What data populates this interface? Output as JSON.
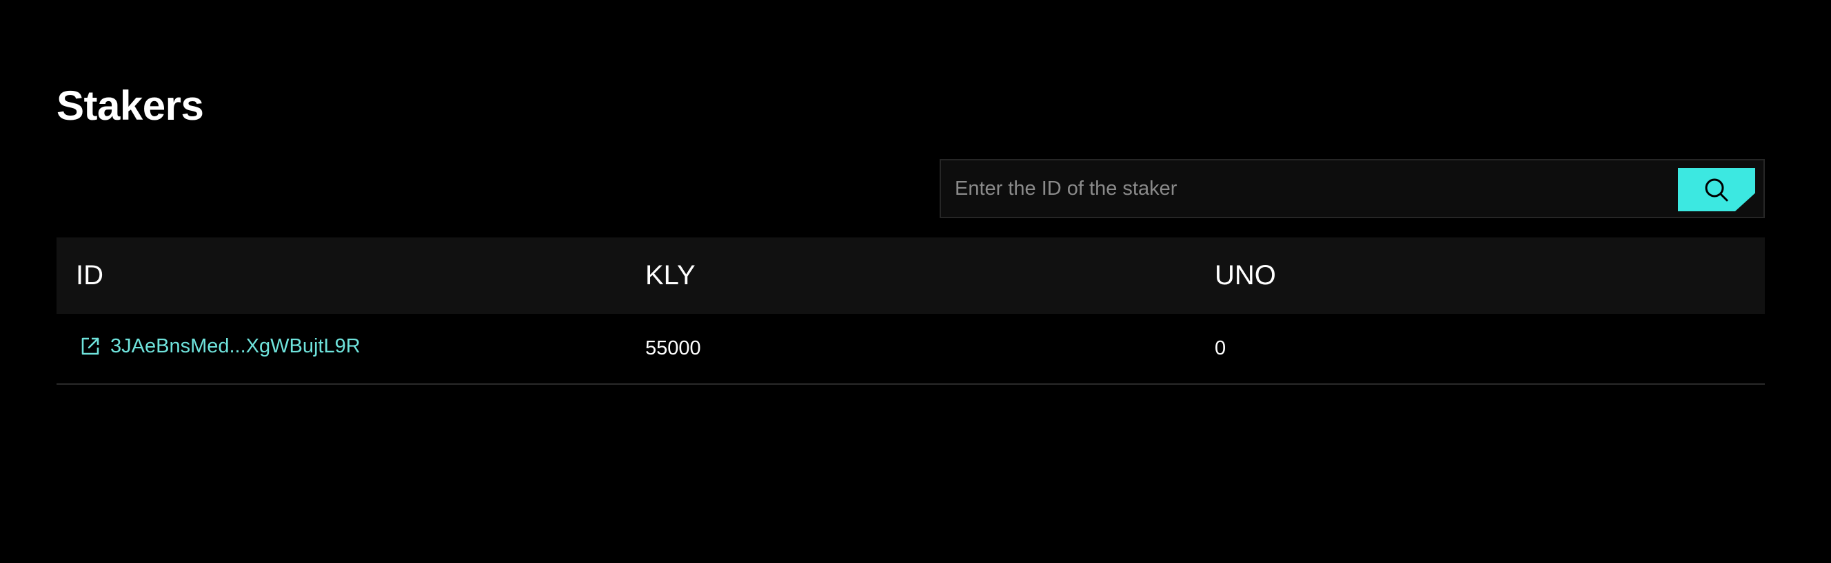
{
  "page": {
    "title": "Stakers"
  },
  "search": {
    "placeholder": "Enter the ID of the staker",
    "value": "",
    "button_icon": "search-icon"
  },
  "table": {
    "columns": [
      "ID",
      "KLY",
      "UNO"
    ],
    "rows": [
      {
        "id": "3JAeBnsMed...XgWBujtL9R",
        "id_icon": "external-link-icon",
        "kly": "55000",
        "uno": "0"
      }
    ]
  },
  "colors": {
    "background": "#000000",
    "accent": "#3ce8e1",
    "link": "#6fe3dc",
    "header_bg": "#111111"
  }
}
